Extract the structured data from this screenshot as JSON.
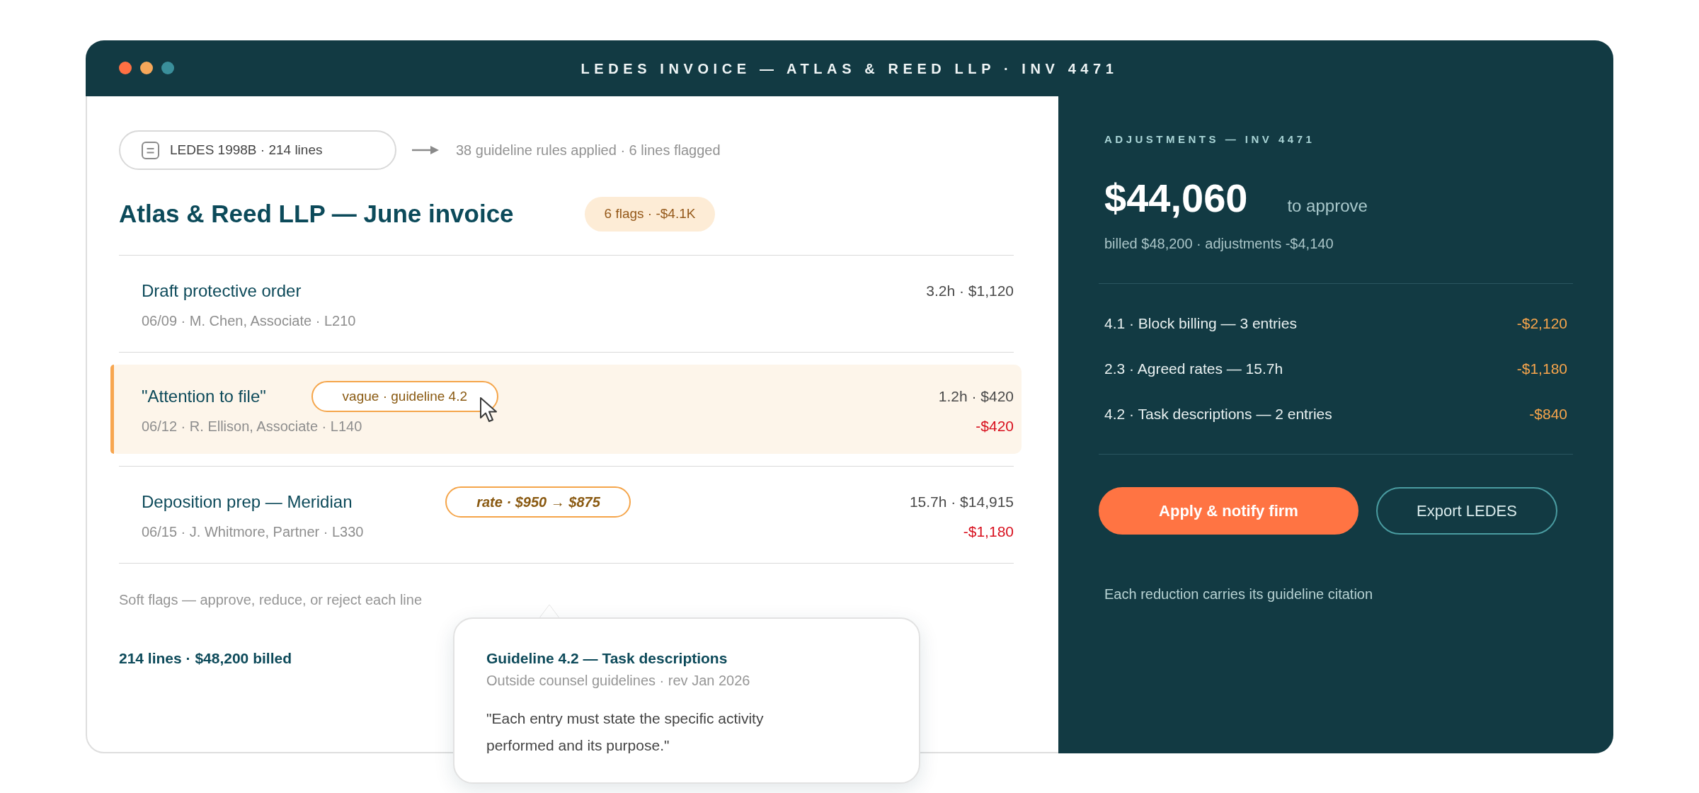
{
  "window": {
    "title": "LEDES INVOICE — ATLAS & REED LLP · INV 4471"
  },
  "source": {
    "file_label": "LEDES 1998B · 214 lines",
    "rules_note": "38 guideline rules applied · 6 lines flagged"
  },
  "invoice": {
    "title": "Atlas & Reed LLP — June invoice",
    "flag_badge": "6 flags · -$4.1K"
  },
  "lines": [
    {
      "title": "Draft protective order",
      "meta": "06/09 · M. Chen, Associate · L210",
      "amount": "3.2h · $1,120",
      "selected": false
    },
    {
      "title": "\"Attention to file\"",
      "tag": {
        "kind": "note",
        "label": "vague · guideline 4.2",
        "hovered": true
      },
      "meta": "06/12 · R. Ellison, Associate · L140",
      "amount": "1.2h · $420",
      "reduction": "-$420",
      "selected": true
    },
    {
      "title": "Deposition prep — Meridian",
      "tag": {
        "kind": "rate",
        "label": "rate · $950 → $875",
        "hovered": false
      },
      "meta": "06/15 · J. Whitmore, Partner · L330",
      "amount": "15.7h · $14,915",
      "reduction": "-$1,180",
      "selected": false
    }
  ],
  "review_note": "Soft flags — approve, reduce, or reject each line",
  "totals": "214 lines · $48,200 billed",
  "tooltip": {
    "title": "Guideline 4.2 — Task descriptions",
    "source": "Outside counsel guidelines · rev Jan 2026",
    "quote": "\"Each entry must state the specific activity performed and its purpose.\""
  },
  "adjustments": {
    "heading": "ADJUSTMENTS — INV 4471",
    "total": "$44,060",
    "total_caption": "to approve",
    "breakdown": "billed $48,200 · adjustments -$4,140",
    "items": [
      {
        "label": "4.1 · Block billing — 3 entries",
        "amount": "-$2,120"
      },
      {
        "label": "2.3 · Agreed rates — 15.7h",
        "amount": "-$1,180"
      },
      {
        "label": "4.2 · Task descriptions — 2 entries",
        "amount": "-$840"
      }
    ],
    "buttons": [
      {
        "kind": "primary",
        "label": "Apply & notify firm"
      },
      {
        "kind": "secondary",
        "label": "Export LEDES"
      }
    ],
    "footnote": "Each reduction carries its guideline citation"
  }
}
